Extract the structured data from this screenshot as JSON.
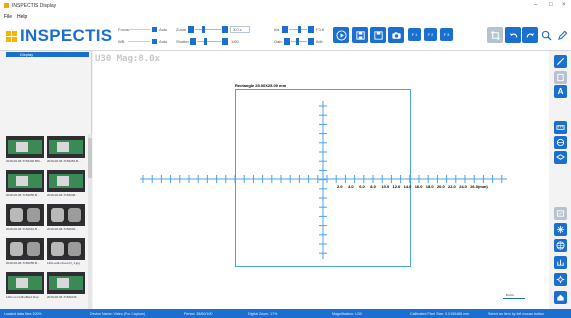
{
  "window": {
    "title": "INSPECTIS Display",
    "min_glyph": "–",
    "max_glyph": "□",
    "close_glyph": "×"
  },
  "menu": {
    "file": "File",
    "help": "Help"
  },
  "logo": {
    "text": "INSPECTIS"
  },
  "controls": {
    "focus_label": "Focus",
    "white_balance_label": "WB",
    "auto_label": "Auto",
    "zoom_label": "Zoom",
    "zoom_value": "3.0 x",
    "shutter_label": "Shutter",
    "shutter_value": "1/60",
    "iris_label": "Iris",
    "iris_value": "F3.6",
    "gain_label": "Gain",
    "gain_value": "6db"
  },
  "toolbar": {
    "ch1": "F 1",
    "ch2": "F 2",
    "ch3": "F 3"
  },
  "tree": {
    "selected_item": "Display"
  },
  "thumbnails": [
    {
      "caption": "2019-06-06-T153402.BM...",
      "style": "pcb"
    },
    {
      "caption": "2019-06-06-T153354.B...",
      "style": "pcb"
    },
    {
      "caption": "2019-06-06-T153055.B...",
      "style": "pcb"
    },
    {
      "caption": "2019-06-06-T153048...",
      "style": "pcb"
    },
    {
      "caption": "2019-06-06-T152610.B...",
      "style": "dark"
    },
    {
      "caption": "2019-06-06-T152602...",
      "style": "dark"
    },
    {
      "caption": "2019-06-06-T152055.B...",
      "style": "dark"
    },
    {
      "caption": "120x-edit-c0-ext-N_1.jpg",
      "style": "dark"
    },
    {
      "caption": "120x-cc-N-Modified.bmp",
      "style": "pcb"
    },
    {
      "caption": "2019-06-06-T15260.B...",
      "style": "pcb"
    }
  ],
  "viewer": {
    "overlay_tag": "U30  Mag:8.0x",
    "rectangle_label": "Rectangle 25.00X25.00 mm",
    "ruler_labels": [
      "2.0",
      "4.0",
      "6.0",
      "8.0",
      "10.0",
      "12.0",
      "14.0",
      "16.0",
      "18.0",
      "20.0",
      "22.0",
      "24.0",
      "26.0(mm)"
    ],
    "scale_label": "6 mm"
  },
  "right_toolbar": {
    "text_tool": "A"
  },
  "status": {
    "disk": "Loaded data files 100%",
    "device": "Device Name: Video (For Capture)",
    "period": "Period: 38/60/100",
    "digital_zoom": "Digital Zoom: 1?%",
    "magnification": "Magnification: U30",
    "calibrated": "Calibrated Pixel Size: 0.0150488 mm",
    "hint": "Select an item by left mouse button"
  },
  "colors": {
    "accent": "#1a6fd1",
    "logo_mark": "#f5b400",
    "measure_rect": "#4aa3e8"
  }
}
